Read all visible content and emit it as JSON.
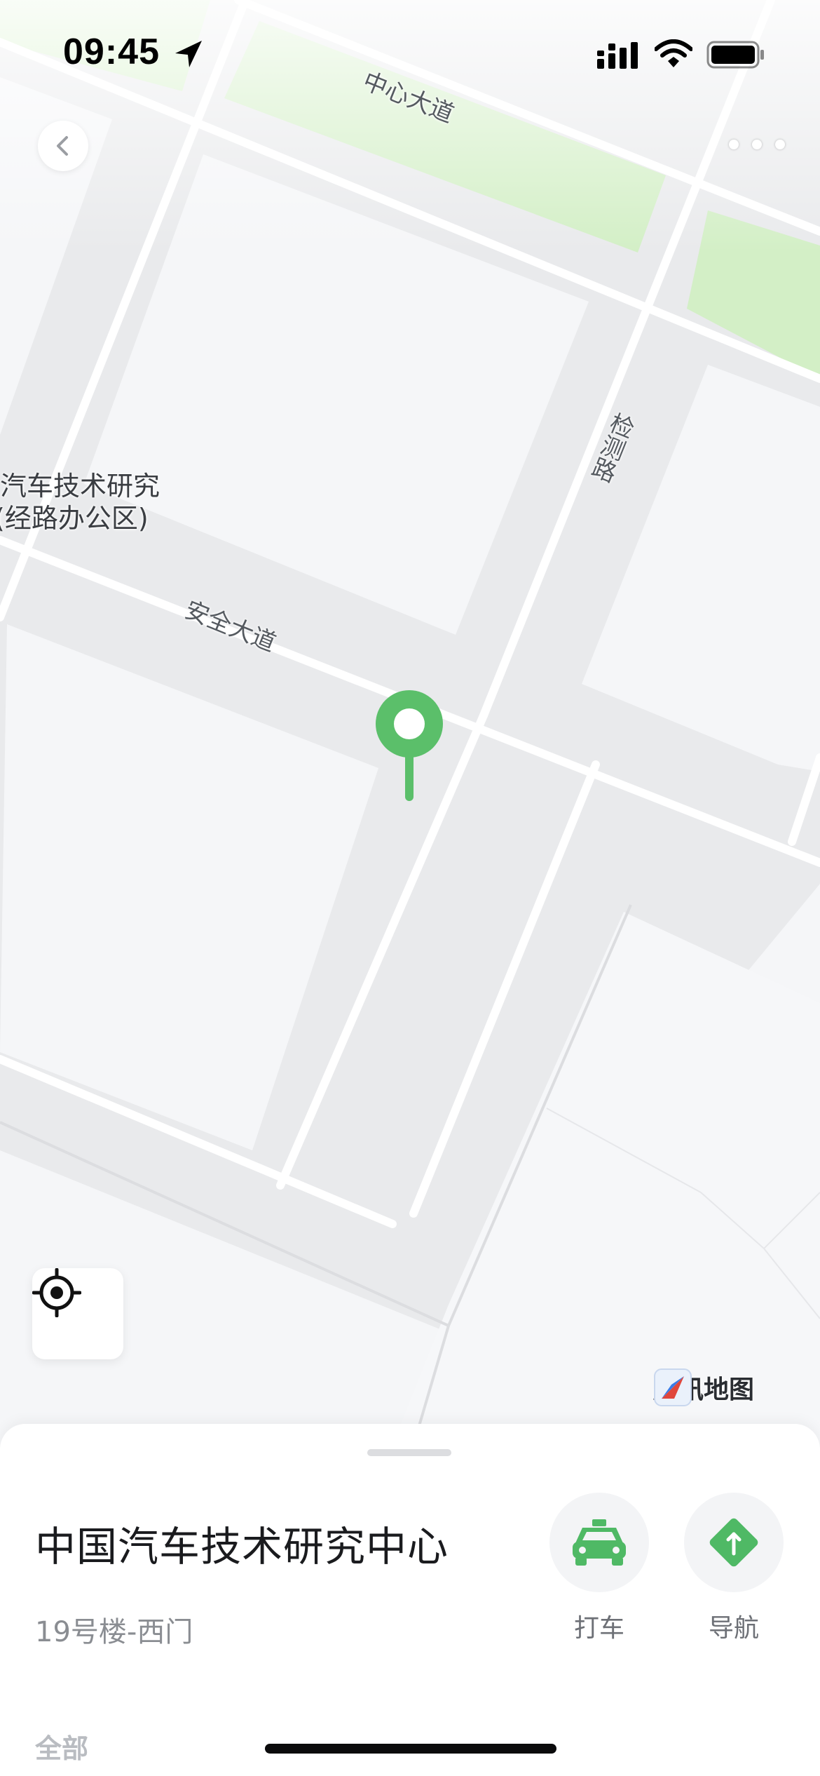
{
  "status_bar": {
    "time": "09:45",
    "icons": [
      "location-arrow-icon",
      "signal-icon",
      "wifi-icon",
      "battery-icon"
    ]
  },
  "top_bar": {
    "back_icon": "chevron-left-icon",
    "more_icon": "more-dots-icon"
  },
  "map": {
    "road_labels": {
      "zhongxin": "中心大道",
      "jiance": "检测路",
      "anquan": "安全大道"
    },
    "poi_label": {
      "line1": "汽车技术研究",
      "line2": "(经路办公区)"
    },
    "pin_color": "#5bbf6a",
    "park_color": "#d6f2c9",
    "provider": "腾讯地图"
  },
  "sheet": {
    "title": "中国汽车技术研究中心",
    "subtitle": "19号楼-西门",
    "actions": {
      "taxi": {
        "label": "打车",
        "icon": "taxi-icon"
      },
      "navigate": {
        "label": "导航",
        "icon": "navigation-icon"
      }
    },
    "filter_tab": "全部"
  },
  "colors": {
    "accent_green": "#4fb965"
  }
}
